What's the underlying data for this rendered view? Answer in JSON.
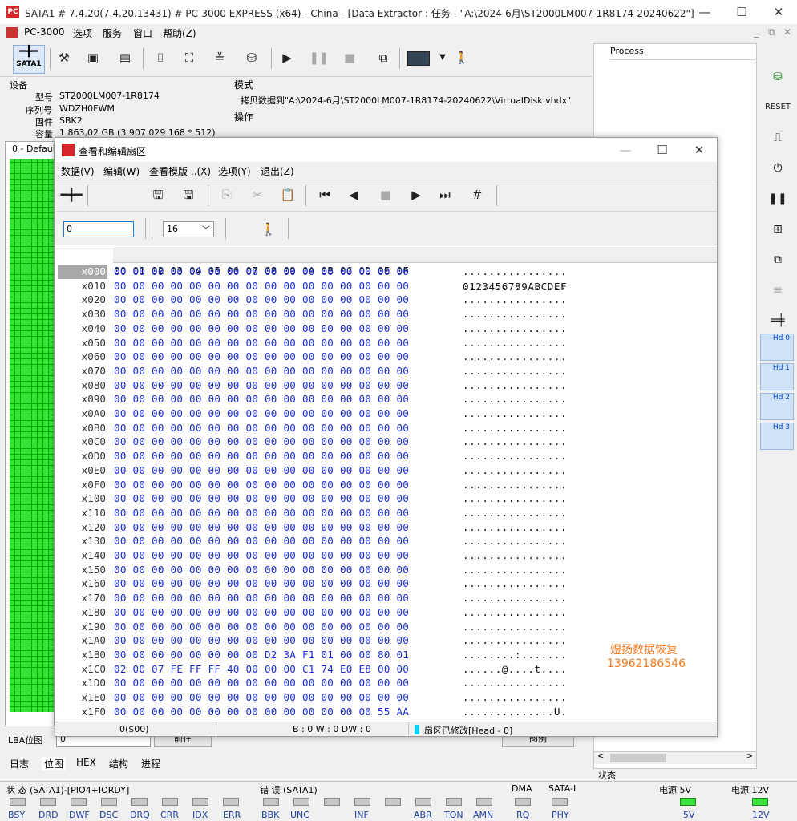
{
  "main_window": {
    "title": "SATA1 # 7.4.20(7.4.20.13431) # PC-3000 EXPRESS (x64) - China - [Data Extractor : 任务 - \"A:\\2024-6月\\ST2000LM007-1R8174-20240622\"]",
    "app_name": "PC-3000",
    "menu": [
      "选项",
      "服务",
      "窗口",
      "帮助(Z)"
    ],
    "toolbar_first_label": "SATA1"
  },
  "device": {
    "header": "设备",
    "model_label": "型号",
    "model": "ST2000LM007-1R8174",
    "serial_label": "序列号",
    "serial": "WDZH0FWM",
    "firmware_label": "固件",
    "firmware": "SBK2",
    "capacity_label": "容量",
    "capacity": "1 863,02 GB (3 907 029 168 * 512)"
  },
  "mode": {
    "header": "模式",
    "copy_text": "拷贝数据到\"A:\\2024-6月\\ST2000LM007-1R8174-20240622\\VirtualDisk.vhdx\"",
    "ops_header": "操作"
  },
  "left_pane": {
    "tab": "0 - Default",
    "lba_label": "LBA位图",
    "lba_value": "0",
    "forward_btn": "前往",
    "legend_btn": "图例"
  },
  "process_pane": {
    "header": "Process",
    "status": "状态"
  },
  "bottom_tabs": [
    "日志",
    "位图",
    "HEX",
    "结构",
    "进程"
  ],
  "status_bar": {
    "state_title": "状 态 (SATA1)-[PIO4+IORDY]",
    "error_title": "错 误 (SATA1)",
    "dma_title": "DMA",
    "sata_title": "SATA-I",
    "p5_title": "电源 5V",
    "p12_title": "电源 12V",
    "state_leds": [
      "BSY",
      "DRD",
      "DWF",
      "DSC",
      "DRQ",
      "CRR",
      "IDX",
      "ERR"
    ],
    "error_leds": [
      "BBK",
      "UNC",
      "",
      "INF",
      "",
      "ABR",
      "TON",
      "AMN"
    ],
    "dma_led": "RQ",
    "sata_led": "PHY",
    "p5_led": "5V",
    "p12_led": "12V"
  },
  "right_bar": {
    "hd_buttons": [
      "Hd 0",
      "Hd 1",
      "Hd 2",
      "Hd 3"
    ]
  },
  "dialog": {
    "title": "查看和编辑扇区",
    "menu": [
      "数据(V)",
      "编辑(W)",
      "查看模版 ..(X)",
      "选项(Y)",
      "退出(Z)"
    ],
    "sector_input": "0",
    "columns_select": "16",
    "header_hex": "00 01 02 03 04 05 06 07 08 09 0A 0B 0C 0D 0E 0F",
    "header_ascii": "0123456789ABCDEF",
    "rows": [
      {
        "off": "x000",
        "hex": "00 00 00 00 00 00 00 00 00 00 00 00 00 00 00 00",
        "asc": "................"
      },
      {
        "off": "x010",
        "hex": "00 00 00 00 00 00 00 00 00 00 00 00 00 00 00 00",
        "asc": "................"
      },
      {
        "off": "x020",
        "hex": "00 00 00 00 00 00 00 00 00 00 00 00 00 00 00 00",
        "asc": "................"
      },
      {
        "off": "x030",
        "hex": "00 00 00 00 00 00 00 00 00 00 00 00 00 00 00 00",
        "asc": "................"
      },
      {
        "off": "x040",
        "hex": "00 00 00 00 00 00 00 00 00 00 00 00 00 00 00 00",
        "asc": "................"
      },
      {
        "off": "x050",
        "hex": "00 00 00 00 00 00 00 00 00 00 00 00 00 00 00 00",
        "asc": "................"
      },
      {
        "off": "x060",
        "hex": "00 00 00 00 00 00 00 00 00 00 00 00 00 00 00 00",
        "asc": "................"
      },
      {
        "off": "x070",
        "hex": "00 00 00 00 00 00 00 00 00 00 00 00 00 00 00 00",
        "asc": "................"
      },
      {
        "off": "x080",
        "hex": "00 00 00 00 00 00 00 00 00 00 00 00 00 00 00 00",
        "asc": "................"
      },
      {
        "off": "x090",
        "hex": "00 00 00 00 00 00 00 00 00 00 00 00 00 00 00 00",
        "asc": "................"
      },
      {
        "off": "x0A0",
        "hex": "00 00 00 00 00 00 00 00 00 00 00 00 00 00 00 00",
        "asc": "................"
      },
      {
        "off": "x0B0",
        "hex": "00 00 00 00 00 00 00 00 00 00 00 00 00 00 00 00",
        "asc": "................"
      },
      {
        "off": "x0C0",
        "hex": "00 00 00 00 00 00 00 00 00 00 00 00 00 00 00 00",
        "asc": "................"
      },
      {
        "off": "x0D0",
        "hex": "00 00 00 00 00 00 00 00 00 00 00 00 00 00 00 00",
        "asc": "................"
      },
      {
        "off": "x0E0",
        "hex": "00 00 00 00 00 00 00 00 00 00 00 00 00 00 00 00",
        "asc": "................"
      },
      {
        "off": "x0F0",
        "hex": "00 00 00 00 00 00 00 00 00 00 00 00 00 00 00 00",
        "asc": "................"
      },
      {
        "off": "x100",
        "hex": "00 00 00 00 00 00 00 00 00 00 00 00 00 00 00 00",
        "asc": "................"
      },
      {
        "off": "x110",
        "hex": "00 00 00 00 00 00 00 00 00 00 00 00 00 00 00 00",
        "asc": "................"
      },
      {
        "off": "x120",
        "hex": "00 00 00 00 00 00 00 00 00 00 00 00 00 00 00 00",
        "asc": "................"
      },
      {
        "off": "x130",
        "hex": "00 00 00 00 00 00 00 00 00 00 00 00 00 00 00 00",
        "asc": "................"
      },
      {
        "off": "x140",
        "hex": "00 00 00 00 00 00 00 00 00 00 00 00 00 00 00 00",
        "asc": "................"
      },
      {
        "off": "x150",
        "hex": "00 00 00 00 00 00 00 00 00 00 00 00 00 00 00 00",
        "asc": "................"
      },
      {
        "off": "x160",
        "hex": "00 00 00 00 00 00 00 00 00 00 00 00 00 00 00 00",
        "asc": "................"
      },
      {
        "off": "x170",
        "hex": "00 00 00 00 00 00 00 00 00 00 00 00 00 00 00 00",
        "asc": "................"
      },
      {
        "off": "x180",
        "hex": "00 00 00 00 00 00 00 00 00 00 00 00 00 00 00 00",
        "asc": "................"
      },
      {
        "off": "x190",
        "hex": "00 00 00 00 00 00 00 00 00 00 00 00 00 00 00 00",
        "asc": "................"
      },
      {
        "off": "x1A0",
        "hex": "00 00 00 00 00 00 00 00 00 00 00 00 00 00 00 00",
        "asc": "................"
      },
      {
        "off": "x1B0",
        "hex": "00 00 00 00 00 00 00 00 D2 3A F1 01 00 00 80 01",
        "asc": "........:......."
      },
      {
        "off": "x1C0",
        "hex": "02 00 07 FE FF FF 40 00 00 00 C1 74 E0 E8 00 00",
        "asc": "......@....t...."
      },
      {
        "off": "x1D0",
        "hex": "00 00 00 00 00 00 00 00 00 00 00 00 00 00 00 00",
        "asc": "................"
      },
      {
        "off": "x1E0",
        "hex": "00 00 00 00 00 00 00 00 00 00 00 00 00 00 00 00",
        "asc": "................"
      },
      {
        "off": "x1F0",
        "hex": "00 00 00 00 00 00 00 00 00 00 00 00 00 00 55 AA",
        "asc": "..............U."
      }
    ],
    "status_pos": "0($00)",
    "status_bwd": "B : 0 W : 0 DW : 0",
    "status_modified": "扇区已修改[Head - 0]",
    "watermark_line1": "煜扬数据恢复",
    "watermark_line2": "13962186546"
  }
}
